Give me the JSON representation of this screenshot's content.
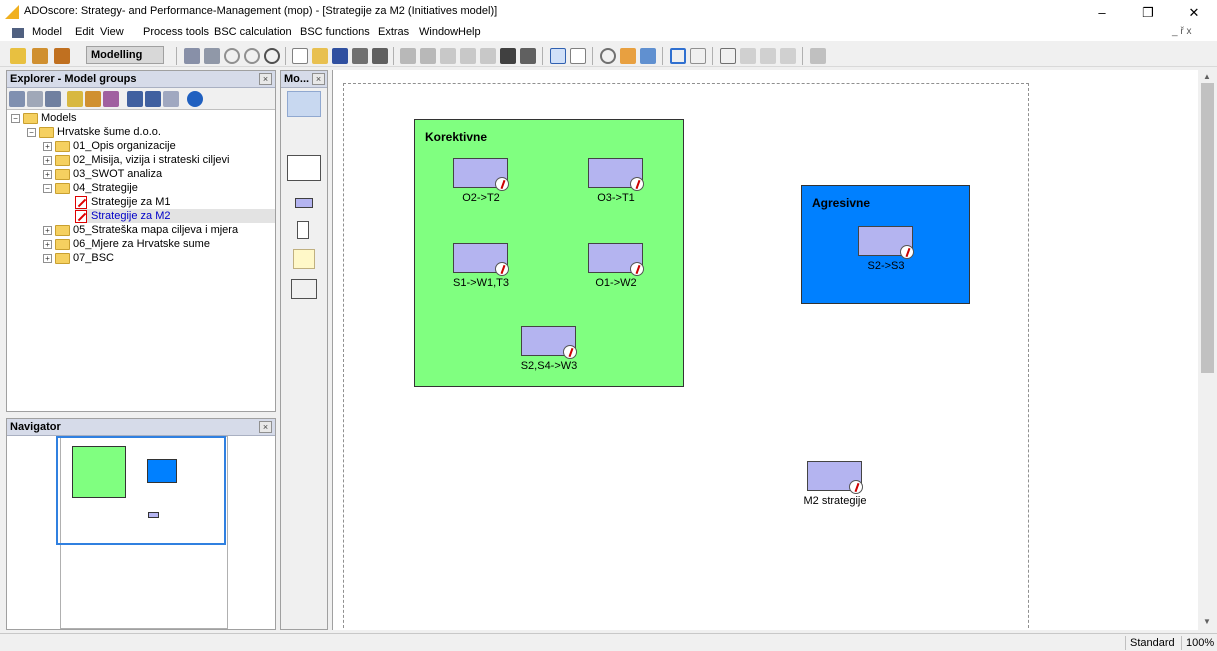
{
  "window": {
    "title": "ADOscore: Strategy- and Performance-Management (mop) - [Strategije za M2 (Initiatives model)]",
    "minimize": "–",
    "restore": "❐",
    "close": "✕",
    "child_controls": "_ ř x"
  },
  "menu": [
    "Model",
    "Edit",
    "View",
    "Process tools",
    "BSC calculation",
    "BSC functions",
    "Extras",
    "Window",
    "Help"
  ],
  "toolbar": {
    "mode": "Modelling"
  },
  "explorer": {
    "title": "Explorer - Model groups",
    "tree": [
      {
        "label": "Models",
        "level": 0,
        "type": "folder",
        "expander": "−"
      },
      {
        "label": "Hrvatske šume d.o.o.",
        "level": 1,
        "type": "folder",
        "expander": "−"
      },
      {
        "label": "01_Opis organizacije",
        "level": 2,
        "type": "folder",
        "expander": "+"
      },
      {
        "label": "02_Misija, vizija i strateski ciljevi",
        "level": 2,
        "type": "folder",
        "expander": "+"
      },
      {
        "label": "03_SWOT analiza",
        "level": 2,
        "type": "folder",
        "expander": "+"
      },
      {
        "label": "04_Strategije",
        "level": 2,
        "type": "folder",
        "expander": "−"
      },
      {
        "label": "Strategije za M1",
        "level": 3,
        "type": "model",
        "expander": ""
      },
      {
        "label": "Strategije za M2",
        "level": 3,
        "type": "model",
        "expander": "",
        "selected": true
      },
      {
        "label": "05_Strateška mapa ciljeva i mjera",
        "level": 2,
        "type": "folder",
        "expander": "+"
      },
      {
        "label": "06_Mjere za Hrvatske sume",
        "level": 2,
        "type": "folder",
        "expander": "+"
      },
      {
        "label": "07_BSC",
        "level": 2,
        "type": "folder",
        "expander": "+"
      }
    ]
  },
  "navigator": {
    "title": "Navigator"
  },
  "modelling_bar": {
    "title": "Mo..."
  },
  "canvas": {
    "containers": [
      {
        "title": "Korektivne",
        "color": "#80ff80"
      },
      {
        "title": "Agresivne",
        "color": "#0080ff"
      }
    ],
    "objects": [
      {
        "label": "O2->T2"
      },
      {
        "label": "O3->T1"
      },
      {
        "label": "S1->W1,T3"
      },
      {
        "label": "O1->W2"
      },
      {
        "label": "S2,S4->W3"
      },
      {
        "label": "S2->S3"
      },
      {
        "label": "M2 strategije"
      }
    ]
  },
  "status": {
    "mode": "Standard",
    "zoom": "100%"
  }
}
